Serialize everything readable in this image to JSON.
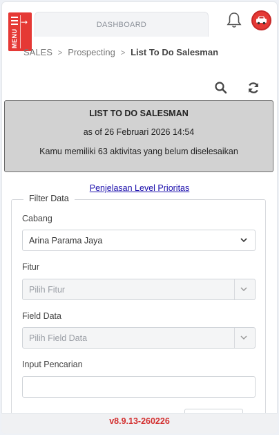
{
  "header": {
    "menu_label": "MENU",
    "dashboard_tab": "DASHBOARD",
    "bell_icon": "bell-icon",
    "avatar_icon": "car-avatar-icon",
    "brand_color": "#e53935"
  },
  "breadcrumb": {
    "items": [
      "SALES",
      "Prospecting",
      "List To Do Salesman"
    ]
  },
  "toolbar": {
    "search_icon": "search-icon",
    "refresh_icon": "refresh-icon"
  },
  "info": {
    "title": "LIST TO DO SALESMAN",
    "as_of": "as of 26 Februari 2026 14:54",
    "message": "Kamu memiliki 63 aktivitas yang belum diselesaikan"
  },
  "priority_link": "Penjelasan Level Prioritas",
  "filter": {
    "legend": "Filter Data",
    "cabang": {
      "label": "Cabang",
      "value": "Arina Parama Jaya"
    },
    "fitur": {
      "label": "Fitur",
      "placeholder": "Pilih Fitur"
    },
    "field_data": {
      "label": "Field Data",
      "placeholder": "Pilih Field Data"
    },
    "input_pencarian": {
      "label": "Input Pencarian",
      "value": ""
    }
  },
  "footer": {
    "version": "v8.9.13-260226",
    "version_color": "#d32f2f"
  }
}
